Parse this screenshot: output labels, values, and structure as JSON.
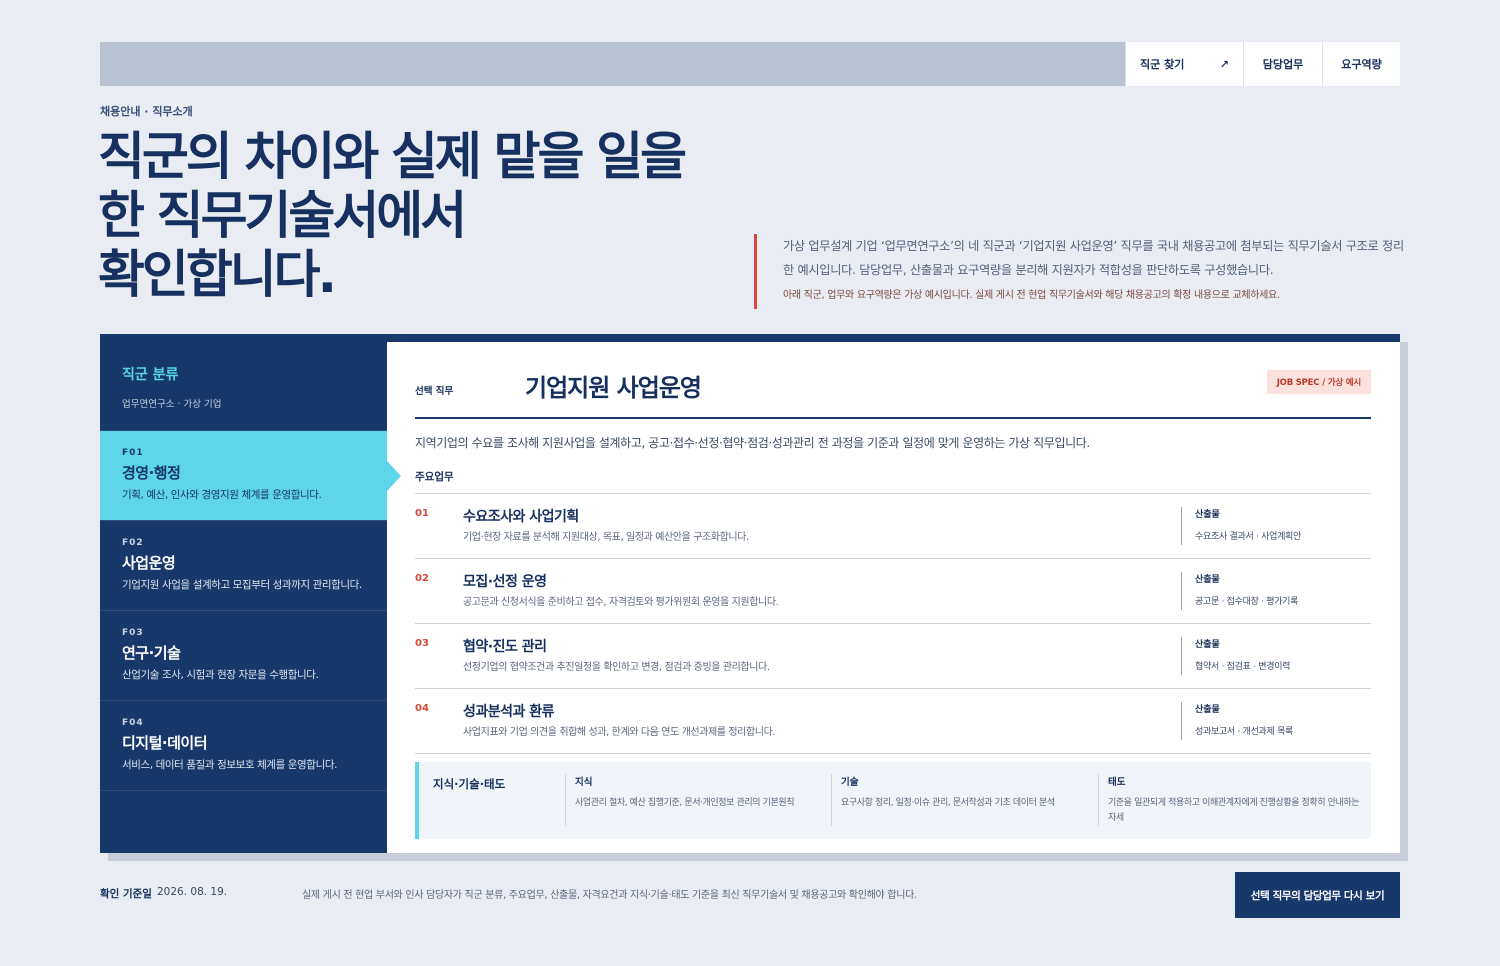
{
  "nav": {
    "find": "직군 찾기",
    "find_icon": "arrow-up-right-icon",
    "duty": "담당업무",
    "requirements": "요구역량"
  },
  "breadcrumb": "채용안내 · 직무소개",
  "headline": [
    "직군의 차이와 실제 맡을 일을",
    "한 직무기술서에서",
    "확인합니다."
  ],
  "intro": {
    "main": "가상 업무설계 기업 ‘업무면연구소’의 네 직군과 ‘기업지원 사업운영’ 직무를 국내 채용공고에 첨부되는 직무기술서 구조로 정리한 예시입니다. 담당업무, 산출물과 요구역량을 분리해 지원자가 적합성을 판단하도록 구성했습니다.",
    "note": "아래 직군, 업무와 요구역량은 가상 예시입니다. 실제 게시 전 현업 직무기술서와 해당 채용공고의 확정 내용으로 교체하세요."
  },
  "sidebar": {
    "title": "직군 분류",
    "subtitle": "업무면연구소 · 가상 기업",
    "items": [
      {
        "code": "F01",
        "name": "경영·행정",
        "desc": "기획, 예산, 인사와 경영지원 체계를 운영합니다."
      },
      {
        "code": "F02",
        "name": "사업운영",
        "desc": "기업지원 사업을 설계하고 모집부터 성과까지 관리합니다."
      },
      {
        "code": "F03",
        "name": "연구·기술",
        "desc": "산업기술 조사, 시험과 현장 자문을 수행합니다."
      },
      {
        "code": "F04",
        "name": "디지털·데이터",
        "desc": "서비스, 데이터 품질과 정보보호 체계를 운영합니다."
      }
    ]
  },
  "job": {
    "label": "선택 직무",
    "title": "기업지원 사업운영",
    "badge": "JOB SPEC / 가상 예시",
    "desc": "지역기업의 수요를 조사해 지원사업을 설계하고, 공고·접수·선정·협약·점검·성과관리 전 과정을 기준과 일정에 맞게 운영하는 가상 직무입니다.",
    "duties_label": "주요업무",
    "output_label": "산출물",
    "duties": [
      {
        "num": "01",
        "title": "수요조사와 사업기획",
        "desc": "기업·현장 자료를 분석해 지원대상, 목표, 일정과 예산안을 구조화합니다.",
        "output": "수요조사 결과서 · 사업계획안"
      },
      {
        "num": "02",
        "title": "모집·선정 운영",
        "desc": "공고문과 신청서식을 준비하고 접수, 자격검토와 평가위원회 운영을 지원합니다.",
        "output": "공고문 · 접수대장 · 평가기록"
      },
      {
        "num": "03",
        "title": "협약·진도 관리",
        "desc": "선정기업의 협약조건과 추진일정을 확인하고 변경, 점검과 증빙을 관리합니다.",
        "output": "협약서 · 점검표 · 변경이력"
      },
      {
        "num": "04",
        "title": "성과분석과 환류",
        "desc": "사업지표와 기업 의견을 취합해 성과, 한계와 다음 연도 개선과제를 정리합니다.",
        "output": "성과보고서 · 개선과제 목록"
      }
    ]
  },
  "ksa": {
    "title": "지식·기술·태도",
    "knowledge": {
      "label": "지식",
      "text": "사업관리 절차, 예산 집행기준, 문서·개인정보 관리의 기본원칙"
    },
    "skill": {
      "label": "기술",
      "text": "요구사항 정리, 일정·이슈 관리, 문서작성과 기초 데이터 분석"
    },
    "attitude": {
      "label": "태도",
      "text": "기준을 일관되게 적용하고 이해관계자에게 진행상황을 정확히 안내하는 자세"
    }
  },
  "footer": {
    "date_label": "확인 기준일",
    "date": "2026. 08. 19.",
    "note": "실제 게시 전 현업 부서와 인사 담당자가 직군 분류, 주요업무, 산출물, 자격요건과 지식·기술·태도 기준을 최신 직무기술서 및 채용공고와 확인해야 합니다.",
    "button": "선택 직무의 담당업무 다시 보기"
  },
  "colors": {
    "navy": "#17386b",
    "cyan": "#5ed5e8",
    "red": "#d6483a",
    "background": "#e9ecf2"
  }
}
